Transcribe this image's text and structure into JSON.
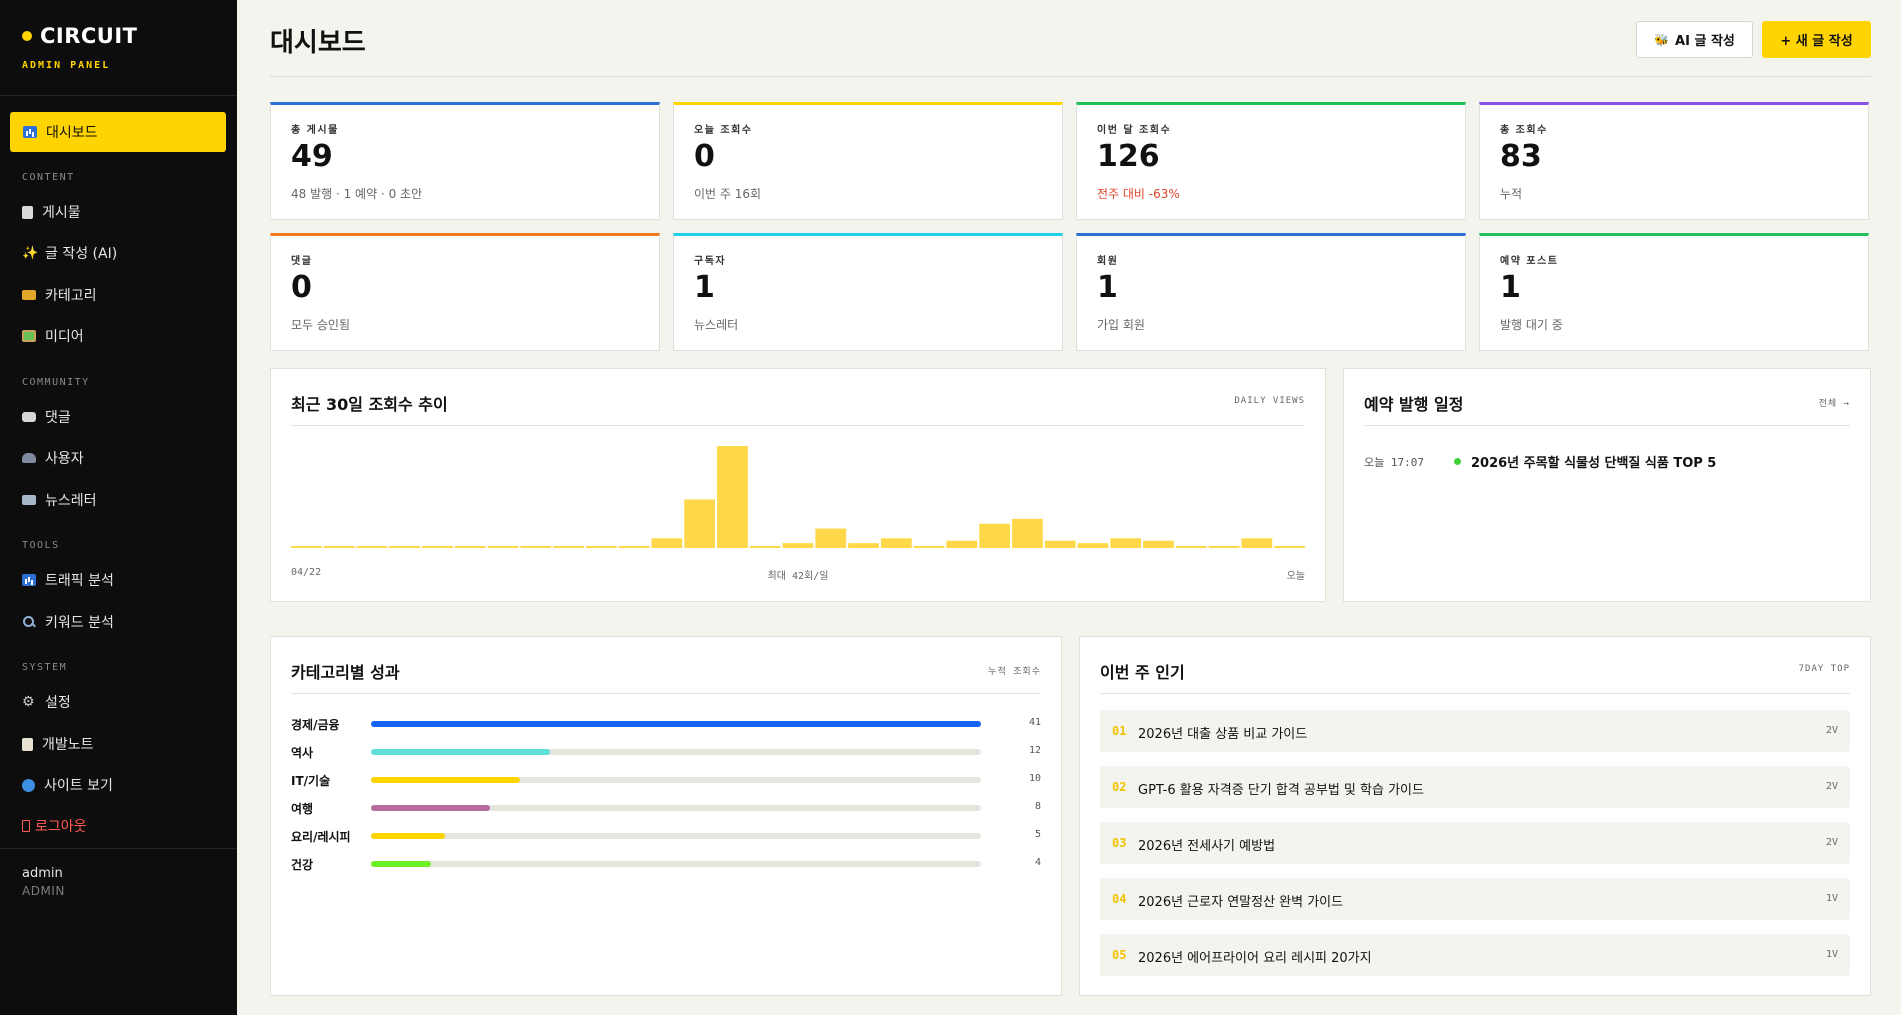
{
  "sidebar": {
    "brand": "CIRCUIT",
    "brand_sub": "ADMIN PANEL",
    "active_item": "대시보드",
    "sections": {
      "content": "CONTENT",
      "community": "COMMUNITY",
      "tools": "TOOLS",
      "system": "SYSTEM"
    },
    "items": {
      "posts": "게시물",
      "ai_write": "글 작성 (AI)",
      "categories": "카테고리",
      "media": "미디어",
      "comments": "댓글",
      "users": "사용자",
      "newsletter": "뉴스레터",
      "traffic": "트래픽 분석",
      "keywords": "키워드 분석",
      "settings": "설정",
      "devnotes": "개발노트",
      "view_site": "사이트 보기",
      "logout": "로그아웃"
    },
    "user": {
      "name": "admin",
      "role": "ADMIN"
    }
  },
  "header": {
    "title": "대시보드",
    "ai_button": "AI 글 작성",
    "new_button": "+ 새 글 작성"
  },
  "stats": [
    {
      "label": "총 게시물",
      "value": "49",
      "sub": "48 발행 · 1 예약 · 0 초안",
      "color": "#2e6fd6"
    },
    {
      "label": "오늘 조회수",
      "value": "0",
      "sub": "이번 주 16회",
      "color": "#ffd400"
    },
    {
      "label": "이번 달 조회수",
      "value": "126",
      "sub": "전주 대비 -63%",
      "color": "#21c05a"
    },
    {
      "label": "총 조회수",
      "value": "83",
      "sub": "누적",
      "color": "#8a4fe6"
    },
    {
      "label": "댓글",
      "value": "0",
      "sub": "모두 승인됨",
      "color": "#f07a1c"
    },
    {
      "label": "구독자",
      "value": "1",
      "sub": "뉴스레터",
      "color": "#20d2e6"
    },
    {
      "label": "회원",
      "value": "1",
      "sub": "가입 회원",
      "color": "#2e6fd6"
    },
    {
      "label": "예약 포스트",
      "value": "1",
      "sub": "발행 대기 중",
      "color": "#21c05a"
    }
  ],
  "views_panel": {
    "title": "최근 30일 조회수 추이",
    "tag": "DAILY VIEWS",
    "axis_start": "04/22",
    "axis_mid": "최대 42회/일",
    "axis_end": "오늘"
  },
  "chart_data": {
    "type": "bar",
    "title": "최근 30일 조회수 추이",
    "ylim": [
      0,
      42
    ],
    "bar_color": "#ffd84a",
    "values": [
      0,
      0,
      0,
      0,
      0,
      0,
      0,
      0,
      0,
      0,
      0,
      4,
      20,
      42,
      0,
      2,
      8,
      2,
      4,
      0,
      3,
      10,
      12,
      3,
      2,
      4,
      3,
      0,
      0,
      4,
      0
    ]
  },
  "schedule_panel": {
    "title": "예약 발행 일정",
    "link": "전체 →",
    "items": [
      {
        "time": "오늘 17:07",
        "title": "2026년 주목할 식물성 단백질 식품 TOP 5",
        "dot_color": "#3fd13a"
      }
    ]
  },
  "category_panel": {
    "title": "카테고리별 성과",
    "tag": "누적 조회수",
    "max": 41,
    "items": [
      {
        "name": "경제/금융",
        "count": 41,
        "color": "#1463f3"
      },
      {
        "name": "역사",
        "count": 12,
        "color": "#5ce0d8"
      },
      {
        "name": "IT/기술",
        "count": 10,
        "color": "#ffd400"
      },
      {
        "name": "여행",
        "count": 8,
        "color": "#b56aa0"
      },
      {
        "name": "요리/레시피",
        "count": 5,
        "color": "#ffd400"
      },
      {
        "name": "건강",
        "count": 4,
        "color": "#6cf024"
      }
    ]
  },
  "popular_panel": {
    "title": "이번 주 인기",
    "tag": "7DAY TOP",
    "items": [
      {
        "rank": "01",
        "title": "2026년 대출 상품 비교 가이드",
        "views": "2V"
      },
      {
        "rank": "02",
        "title": "GPT-6 활용 자격증 단기 합격 공부법 및 학습 가이드",
        "views": "2V"
      },
      {
        "rank": "03",
        "title": "2026년 전세사기 예방법",
        "views": "2V"
      },
      {
        "rank": "04",
        "title": "2026년 근로자 연말정산 완벽 가이드",
        "views": "1V"
      },
      {
        "rank": "05",
        "title": "2026년 에어프라이어 요리 레시피 20가지",
        "views": "1V"
      }
    ]
  }
}
